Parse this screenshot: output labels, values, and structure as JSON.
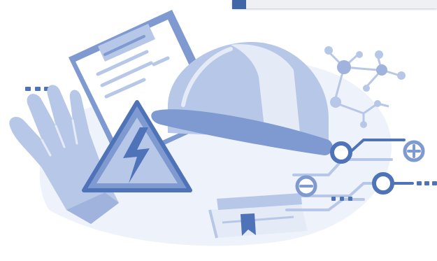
{
  "colors": {
    "deep": "#4f73b8",
    "mid": "#7f9ad0",
    "light": "#b7c7e8",
    "pale": "#e4ebf7",
    "bg_blob": "#eef2fa",
    "white": "#ffffff",
    "topbar": "#eef0f4",
    "topbar_accent": "#4166a8"
  },
  "icons": [
    "clipboard-icon",
    "hard-hat-icon",
    "high-voltage-warning-icon",
    "work-glove-icon",
    "molecule-icon",
    "circuit-icon",
    "plus-icon",
    "minus-icon",
    "book-icon",
    "bookmark-icon",
    "ellipsis-icon"
  ]
}
